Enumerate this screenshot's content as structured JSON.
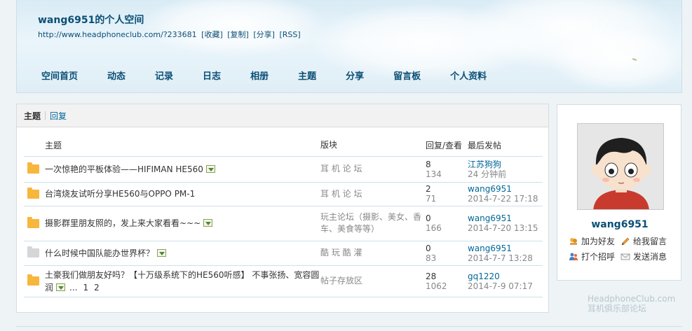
{
  "header": {
    "title": "wang6951的个人空间",
    "url": "http://www.headphoneclub.com/?233681",
    "url_actions": [
      "[收藏]",
      "[复制]",
      "[分享]",
      "[RSS]"
    ]
  },
  "nav": [
    "空间首页",
    "动态",
    "记录",
    "日志",
    "相册",
    "主题",
    "分享",
    "留言板",
    "个人资料"
  ],
  "tabs": {
    "active": "主题",
    "other": "回复"
  },
  "table": {
    "headers": {
      "topic": "主题",
      "forum": "版块",
      "count": "回复/查看",
      "last": "最后发帖"
    },
    "rows": [
      {
        "title": "一次惊艳的平板体验——HIFIMAN HE560",
        "forum": "耳 机 论 坛",
        "replies": "8",
        "views": "134",
        "last_user": "江苏狗狗",
        "last_time": "24 分钟前"
      },
      {
        "title": "台湾烧友试听分享HE560与OPPO PM-1",
        "forum": "耳 机 论 坛",
        "replies": "2",
        "views": "71",
        "last_user": "wang6951",
        "last_time": "2014-7-22 17:18"
      },
      {
        "title": "摄影群里朋友照的，发上来大家看看~~~",
        "forum": "玩主论坛（摄影、美女、香车、美食等等）",
        "replies": "0",
        "views": "166",
        "last_user": "wang6951",
        "last_time": "2014-7-20 13:15"
      },
      {
        "title": "什么时候中国队能办世界杯？",
        "forum": "酷 玩 酷 灌",
        "replies": "0",
        "views": "83",
        "last_user": "wang6951",
        "last_time": "2014-7-7 13:28"
      },
      {
        "title": "土豪我们做朋友好吗？【十万级系统下的HE560听感】 不事张扬、宽容圆润",
        "forum": "帖子存放区",
        "replies": "28",
        "views": "1062",
        "last_user": "gq1220",
        "last_time": "2014-7-9 07:17",
        "ellipsis": "...",
        "page1": "1",
        "page2": "2"
      }
    ]
  },
  "profile": {
    "name": "wang6951",
    "actions": {
      "add_friend": "加为好友",
      "leave_message": "给我留言",
      "greet": "打个招呼",
      "send_message": "发送消息"
    }
  },
  "watermark": {
    "line1": "HeadphoneClub.com",
    "line2": "耳机俱乐部论坛"
  },
  "colors": {
    "link": "#006699",
    "title": "#0b4f75",
    "folder": "#f7b63c"
  }
}
